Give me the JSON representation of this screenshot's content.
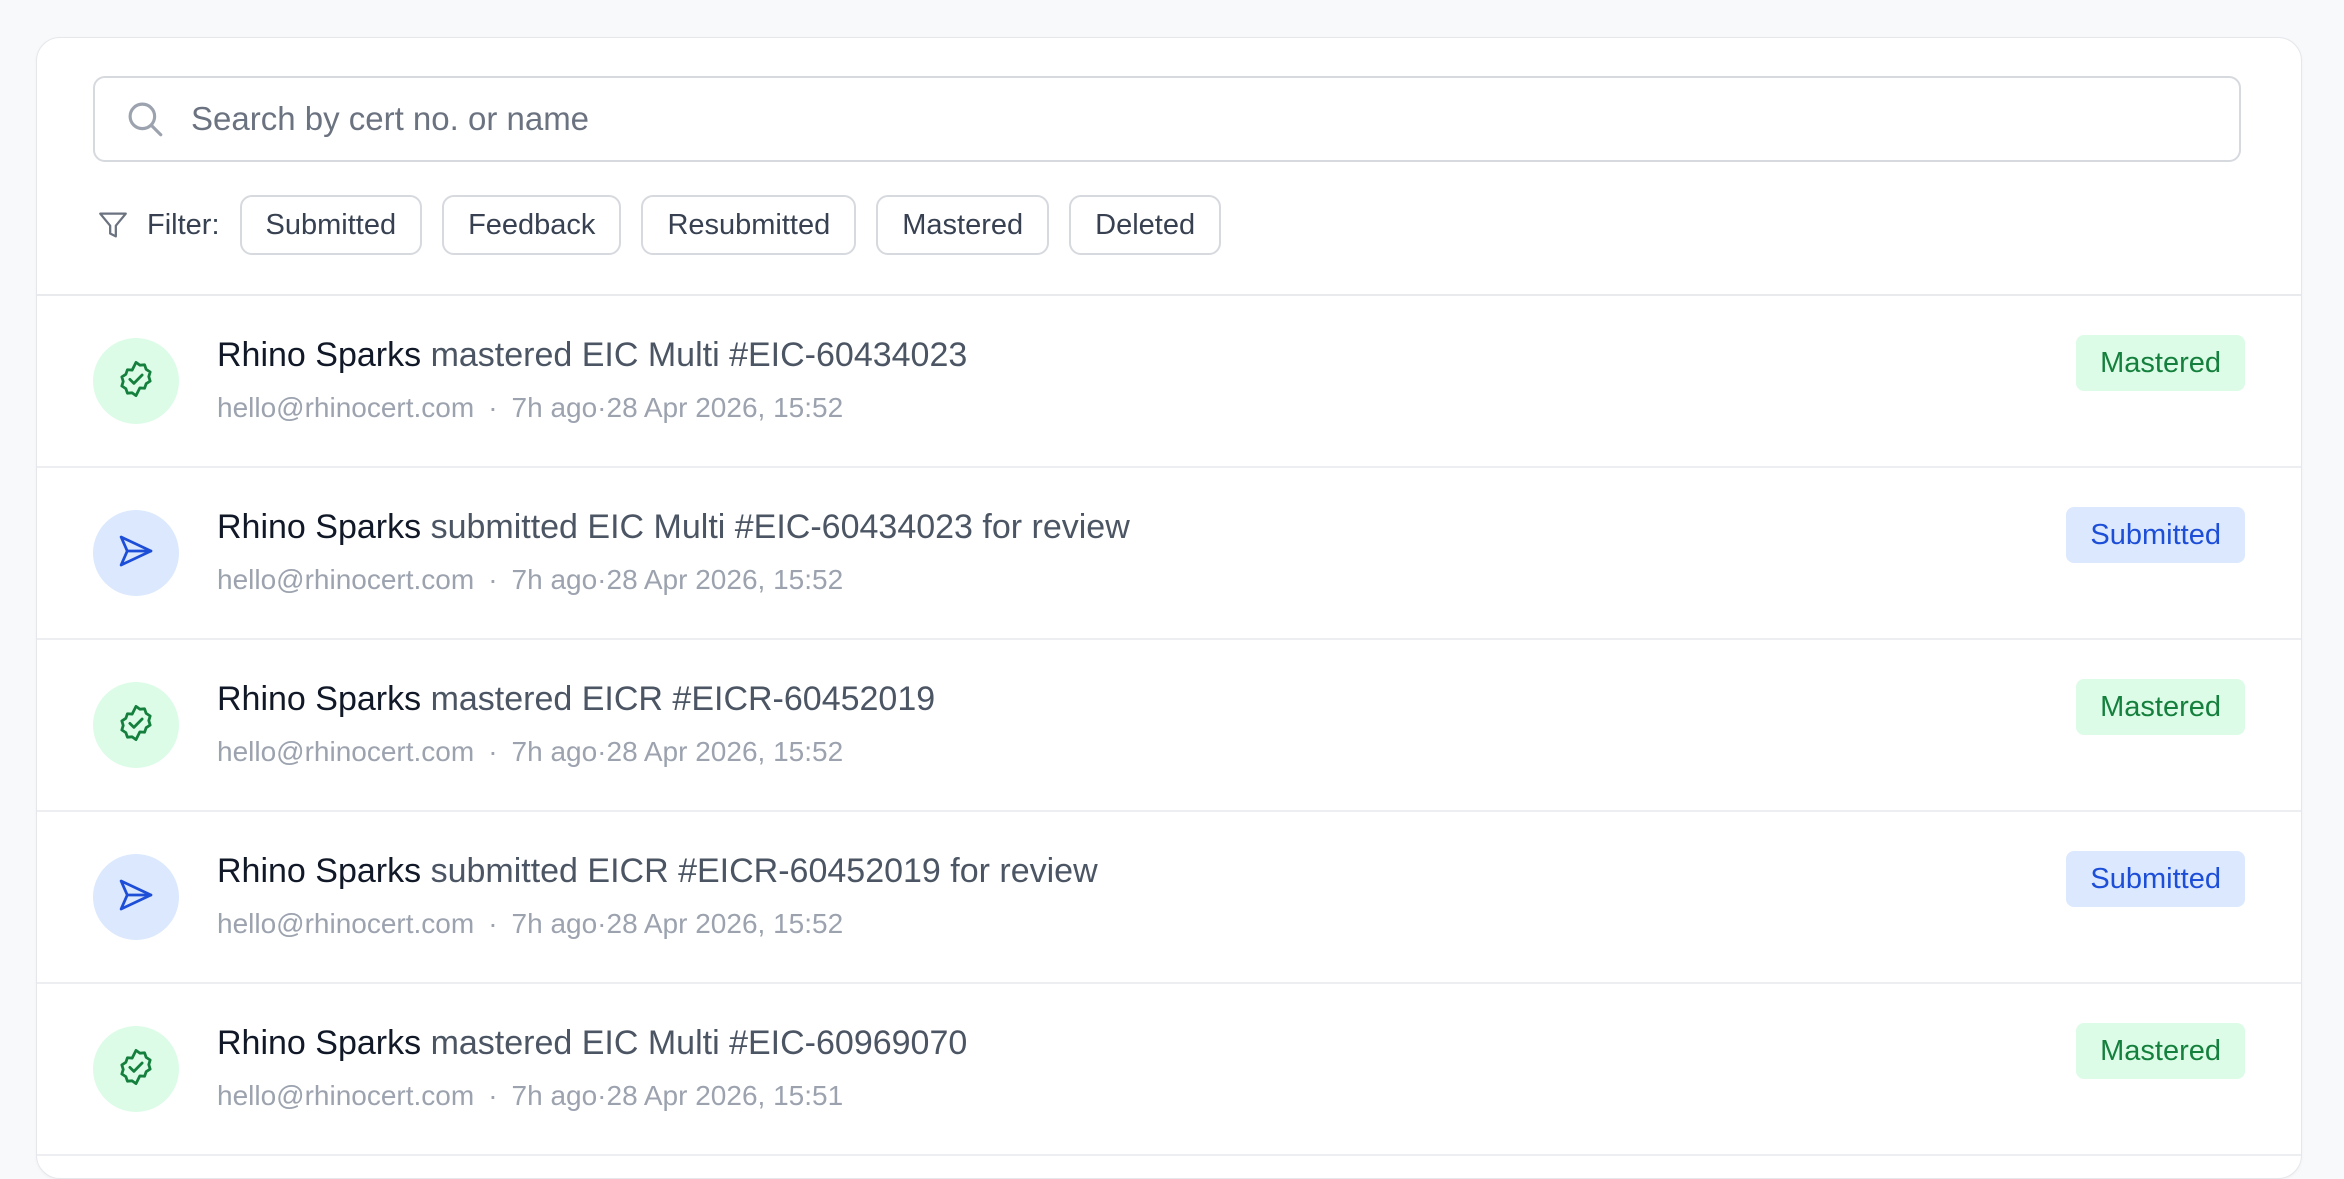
{
  "search": {
    "placeholder": "Search by cert no. or name",
    "icon": "search-icon"
  },
  "filter": {
    "label": "Filter:",
    "icon": "filter-icon",
    "chips": [
      "Submitted",
      "Feedback",
      "Resubmitted",
      "Mastered",
      "Deleted"
    ]
  },
  "colors": {
    "mastered_bg": "#dcfce7",
    "mastered_fg": "#15803d",
    "submitted_bg": "#dbe8fd",
    "submitted_fg": "#1d4ed8"
  },
  "activities": [
    {
      "type": "mastered",
      "icon": "badge-check-icon",
      "name": "Rhino Sparks",
      "action": "mastered EIC Multi #EIC-60434023",
      "email": "hello@rhinocert.com",
      "ago": "7h ago",
      "timestamp": "28 Apr 2026, 15:52",
      "status": "Mastered"
    },
    {
      "type": "submitted",
      "icon": "send-icon",
      "name": "Rhino Sparks",
      "action": "submitted EIC Multi #EIC-60434023 for review",
      "email": "hello@rhinocert.com",
      "ago": "7h ago",
      "timestamp": "28 Apr 2026, 15:52",
      "status": "Submitted"
    },
    {
      "type": "mastered",
      "icon": "badge-check-icon",
      "name": "Rhino Sparks",
      "action": "mastered EICR #EICR-60452019",
      "email": "hello@rhinocert.com",
      "ago": "7h ago",
      "timestamp": "28 Apr 2026, 15:52",
      "status": "Mastered"
    },
    {
      "type": "submitted",
      "icon": "send-icon",
      "name": "Rhino Sparks",
      "action": "submitted EICR #EICR-60452019 for review",
      "email": "hello@rhinocert.com",
      "ago": "7h ago",
      "timestamp": "28 Apr 2026, 15:52",
      "status": "Submitted"
    },
    {
      "type": "mastered",
      "icon": "badge-check-icon",
      "name": "Rhino Sparks",
      "action": "mastered EIC Multi #EIC-60969070",
      "email": "hello@rhinocert.com",
      "ago": "7h ago",
      "timestamp": "28 Apr 2026, 15:51",
      "status": "Mastered"
    }
  ]
}
